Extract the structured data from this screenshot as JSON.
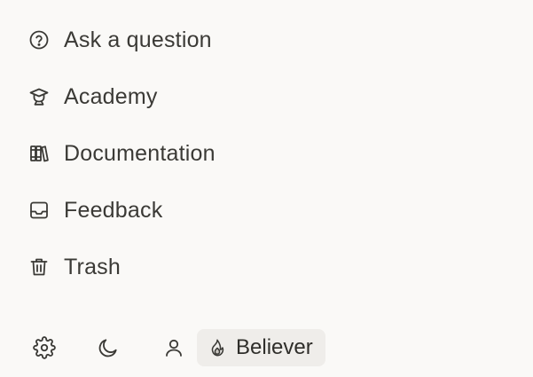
{
  "menu": {
    "items": [
      {
        "label": "Ask a question",
        "icon": "question-circle-icon"
      },
      {
        "label": "Academy",
        "icon": "graduation-cap-icon"
      },
      {
        "label": "Documentation",
        "icon": "books-icon"
      },
      {
        "label": "Feedback",
        "icon": "inbox-icon"
      },
      {
        "label": "Trash",
        "icon": "trash-icon"
      }
    ]
  },
  "footer": {
    "settings_icon": "gear-icon",
    "theme_icon": "moon-icon",
    "profile_icon": "user-icon",
    "plan": {
      "label": "Believer",
      "icon": "flame-icon"
    }
  },
  "colors": {
    "background": "#faf9f7",
    "text": "#3b3a36",
    "badge_background": "#efedea"
  }
}
